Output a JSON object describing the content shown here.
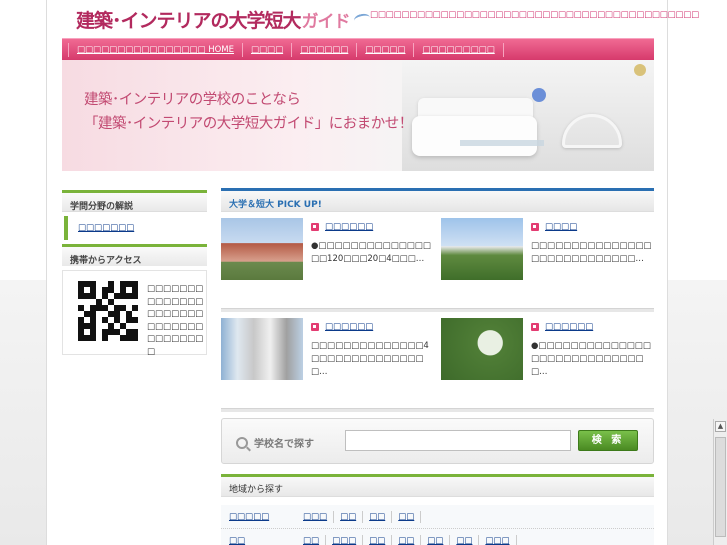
{
  "site": {
    "logo_main": "建築･インテリアの大学短大",
    "logo_accent": "ガイド",
    "tagline": "□□□□□□□□□□□□□□□□□□□□□□□□□□□□□□□□□□□□□□□□□□"
  },
  "nav": {
    "items": [
      {
        "label": "□□□□□□□□□□□□□□□□ HOME"
      },
      {
        "label": "□□□□"
      },
      {
        "label": "□□□□□□"
      },
      {
        "label": "□□□□□"
      },
      {
        "label": "□□□□□□□□□"
      }
    ]
  },
  "hero": {
    "line1": "建築･インテリアの学校のことなら",
    "line2": "「建築･インテリアの大学短大ガイド」におまかせ！"
  },
  "sidebar": {
    "section1_title": "学問分野の解説",
    "section1_link": "□□□□□□□",
    "section2_title": "携帯からアクセス",
    "qr_text": "□□□□□□□□□□□□□□□□□□□□□□□□□□□□□□□□□□□□"
  },
  "pickup": {
    "header": "大学＆短大 PICK UP!",
    "items": [
      {
        "title": "□□□□□□",
        "desc": "●□□□□□□□□□□□□□□□□120□□□20□4□□□…"
      },
      {
        "title": "□□□□",
        "desc": "□□□□□□□□□□□□□□□□□□□□□□□□□□□□…"
      },
      {
        "title": "□□□□□□",
        "desc": "□□□□□□□□□□□□□□4□□□□□□□□□□□□□□□…"
      },
      {
        "title": "□□□□□□",
        "desc": "●□□□□□□□□□□□□□□□□□□□□□□□□□□□□□…"
      }
    ]
  },
  "search": {
    "label": "学校名で探す",
    "placeholder": "",
    "button": "検 索"
  },
  "area": {
    "header": "地域から探す",
    "regions": [
      {
        "name": "□□□□□",
        "prefs": [
          "□□□",
          "□□",
          "□□",
          "□□"
        ]
      },
      {
        "name": "□□",
        "prefs": [
          "□□",
          "□□□",
          "□□",
          "□□",
          "□□",
          "□□",
          "□□□"
        ]
      }
    ]
  }
}
